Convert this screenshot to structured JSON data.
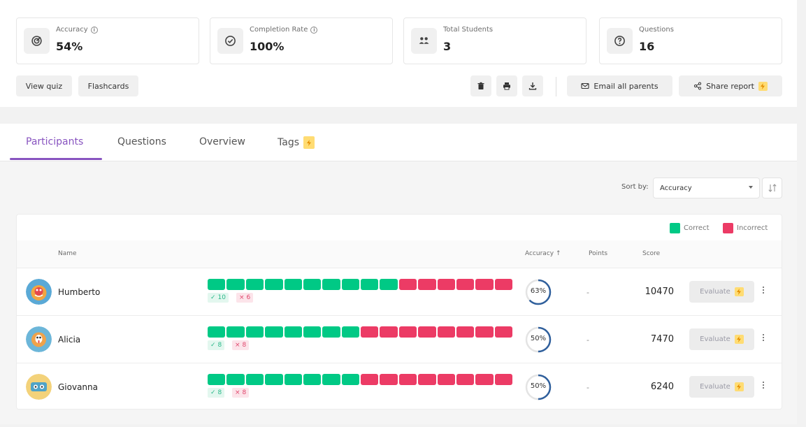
{
  "stats": [
    {
      "label": "Accuracy",
      "value": "54%",
      "icon": "target-icon",
      "info": true
    },
    {
      "label": "Completion Rate",
      "value": "100%",
      "icon": "check-circle-icon",
      "info": true
    },
    {
      "label": "Total Students",
      "value": "3",
      "icon": "users-icon",
      "info": false
    },
    {
      "label": "Questions",
      "value": "16",
      "icon": "question-circle-icon",
      "info": false
    }
  ],
  "toolbar": {
    "view_quiz": "View quiz",
    "flashcards": "Flashcards",
    "email_parents": "Email all parents",
    "share_report": "Share report"
  },
  "tabs": [
    {
      "label": "Participants",
      "active": true
    },
    {
      "label": "Questions",
      "active": false
    },
    {
      "label": "Overview",
      "active": false
    },
    {
      "label": "Tags",
      "active": false,
      "premium": true
    }
  ],
  "sort": {
    "label": "Sort by:",
    "value": "Accuracy"
  },
  "legend": {
    "correct": "Correct",
    "incorrect": "Incorrect"
  },
  "columns": {
    "name": "Name",
    "accuracy": "Accuracy ↑",
    "points": "Points",
    "score": "Score"
  },
  "colors": {
    "accent": "#8854c0",
    "correct": "#00c985",
    "incorrect": "#ec3b65",
    "premium": "#ffdc73",
    "ring": "#2f5f9c"
  },
  "participants": [
    {
      "name": "Humberto",
      "correct": "10",
      "incorrect": "6",
      "correct_count": 10,
      "incorrect_count": 6,
      "accuracy_label": "63%",
      "accuracy": 63,
      "points": "-",
      "score": "10470",
      "evaluate": "Evaluate"
    },
    {
      "name": "Alicia",
      "correct": "8",
      "incorrect": "8",
      "correct_count": 8,
      "incorrect_count": 8,
      "accuracy_label": "50%",
      "accuracy": 50,
      "points": "-",
      "score": "7470",
      "evaluate": "Evaluate"
    },
    {
      "name": "Giovanna",
      "correct": "8",
      "incorrect": "8",
      "correct_count": 8,
      "incorrect_count": 8,
      "accuracy_label": "50%",
      "accuracy": 50,
      "points": "-",
      "score": "6240",
      "evaluate": "Evaluate"
    }
  ]
}
